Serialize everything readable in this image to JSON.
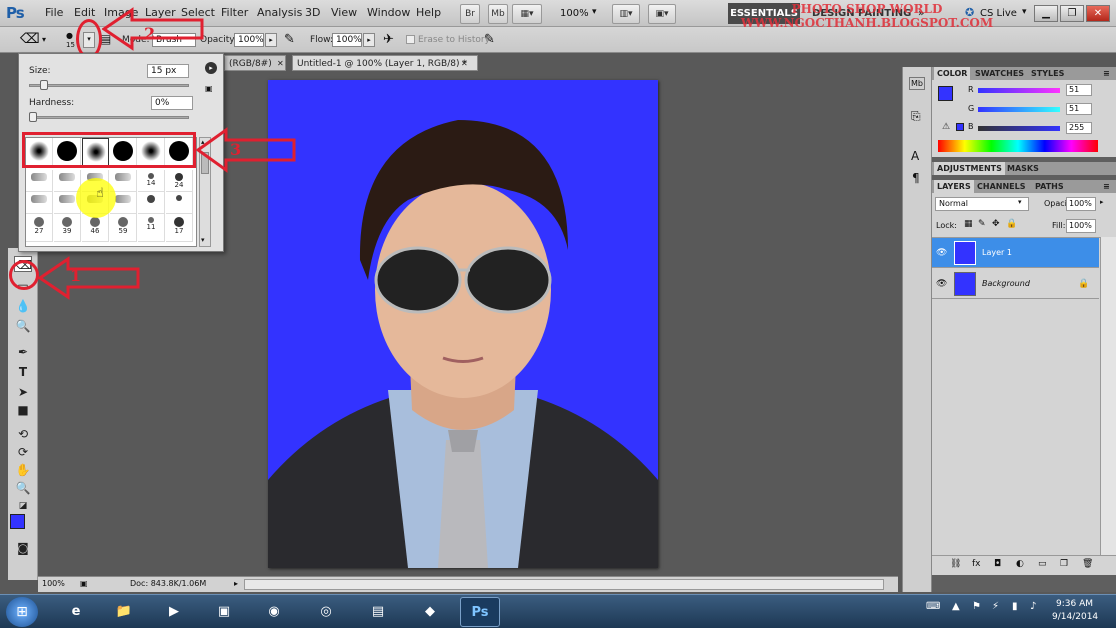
{
  "app": {
    "logo": "Ps"
  },
  "menu": [
    "File",
    "Edit",
    "Image",
    "Layer",
    "Select",
    "Filter",
    "Analysis",
    "3D",
    "View",
    "Window",
    "Help"
  ],
  "menubar_buttons": {
    "br": "Br",
    "mb": "Mb",
    "zoom": "100%"
  },
  "workspace": {
    "essentials": "ESSENTIALS",
    "design": "DESIGN",
    "painting": "PAINTING",
    "more": "»",
    "cs_live": "CS Live"
  },
  "watermark": {
    "line1": "PHOTO SHOP WORLD",
    "line2": "WWW.NGOCTHANH.BLOGSPOT.COM"
  },
  "options": {
    "brush_size_badge": "15",
    "mode_label": "Mode:",
    "mode_value": "Brush",
    "opacity_label": "Opacity:",
    "opacity_value": "100%",
    "flow_label": "Flow:",
    "flow_value": "100%",
    "erase_history": "Erase to History"
  },
  "brush_popup": {
    "size_label": "Size:",
    "size_value": "15 px",
    "hardness_label": "Hardness:",
    "hardness_value": "0%",
    "size_level_percent": 7,
    "hardness_level_percent": 0,
    "row2_nums": [
      "",
      "",
      "",
      "",
      "14",
      "24"
    ],
    "row3_nums": [
      "27",
      "39",
      "46",
      "59",
      "11",
      "17"
    ]
  },
  "doc_tabs": [
    {
      "label": "(RGB/8#)"
    },
    {
      "label": "Untitled-1 @ 100% (Layer 1, RGB/8) *"
    }
  ],
  "status": {
    "zoom": "100%",
    "doc": "Doc: 843.8K/1.06M"
  },
  "color_panel": {
    "tabs": [
      "COLOR",
      "SWATCHES",
      "STYLES"
    ],
    "r_label": "R",
    "r_value": "51",
    "g_label": "G",
    "g_value": "51",
    "b_label": "B",
    "b_value": "255",
    "foreground": "#3333ff"
  },
  "adjustments_tabs": [
    "ADJUSTMENTS",
    "MASKS"
  ],
  "layers_panel": {
    "tabs": [
      "LAYERS",
      "CHANNELS",
      "PATHS"
    ],
    "blend_mode": "Normal",
    "opacity_label": "Opacity:",
    "opacity_value": "100%",
    "lock_label": "Lock:",
    "fill_label": "Fill:",
    "fill_value": "100%",
    "layers": [
      {
        "name": "Layer 1",
        "selected": true
      },
      {
        "name": "Background",
        "selected": false
      }
    ]
  },
  "annotations": {
    "n1": "1",
    "n2": "2",
    "n3": "3"
  },
  "taskbar": {
    "time": "9:36 AM",
    "date": "9/14/2014",
    "apps": [
      "ie-icon",
      "explorer-icon",
      "media-icon",
      "app-icon",
      "firefox-icon",
      "chrome-icon",
      "app2-icon",
      "app3-icon",
      "photoshop-icon"
    ],
    "ps_label": "Ps"
  },
  "colors": {
    "canvas_blue": "#3333ff",
    "annotation_red": "#e02030",
    "selection_blue": "#3d8ee8"
  }
}
